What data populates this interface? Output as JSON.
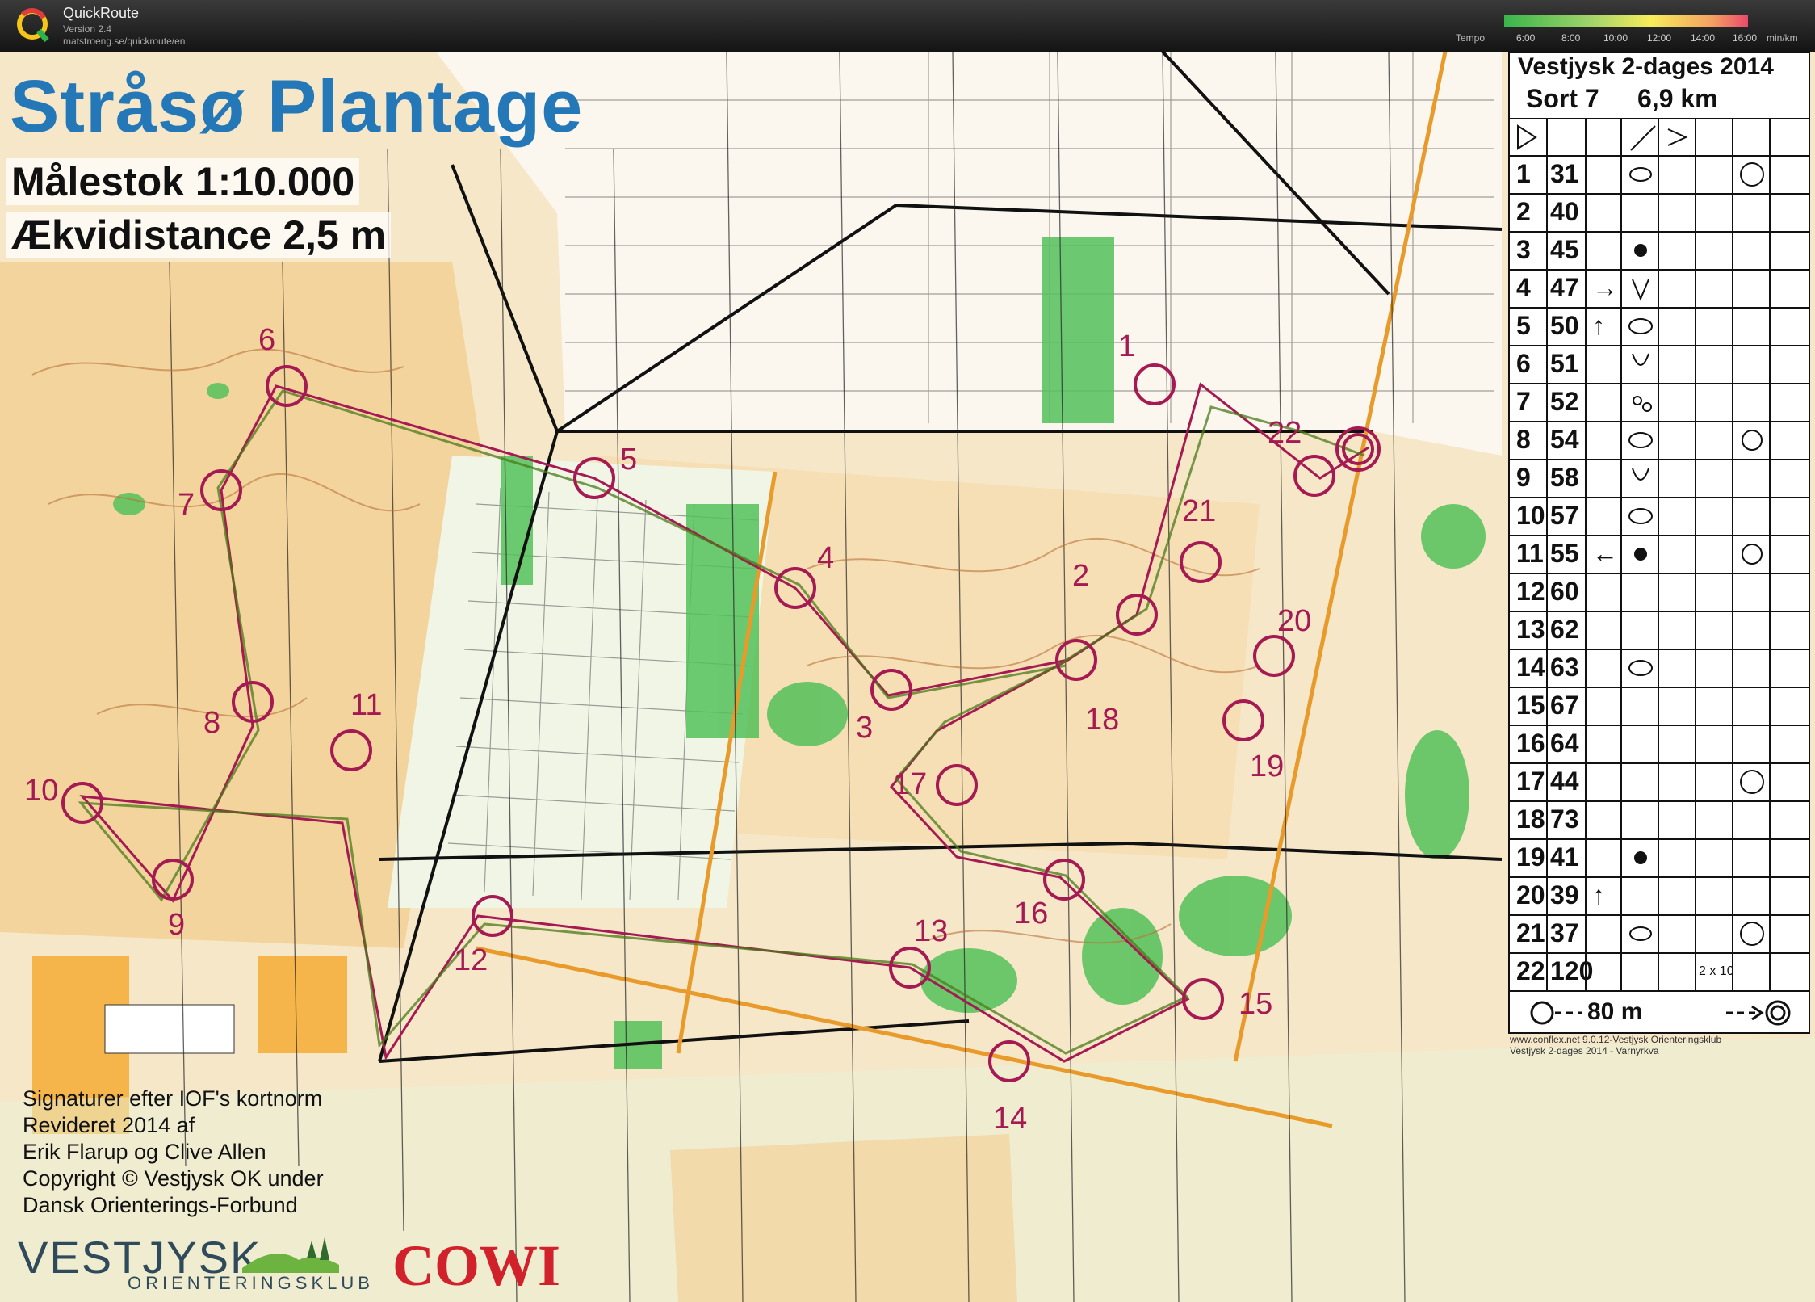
{
  "app": {
    "name": "QuickRoute",
    "version": "Version 2.4",
    "url": "matstroeng.se/quickroute/en",
    "tempo_label": "Tempo",
    "tempo_unit": "min/km",
    "scale_ticks": [
      "6:00",
      "8:00",
      "10:00",
      "12:00",
      "14:00",
      "16:00"
    ]
  },
  "map": {
    "title": "Stråsø Plantage",
    "scale_text": "Målestok 1:10.000",
    "contour_text": "Ækvidistance 2,5 m",
    "credits": [
      "Signaturer efter IOF's kortnorm",
      "Revideret 2014 af",
      "Erik Flarup og Clive Allen",
      "Copyright © Vestjysk OK under",
      "Dansk Orienterings-Forbund"
    ],
    "club_logo": "VESTJYSK",
    "club_logo_sub": "ORIENTERINGSKLUB",
    "sponsor": "COWI",
    "print_note_1": "www.conflex.net 9.0.12-Vestjysk Orienteringsklub",
    "print_note_2": "Vestjysk 2-dages 2014 - Varnyrkva"
  },
  "controls": [
    {
      "label": "1"
    },
    {
      "label": "2"
    },
    {
      "label": "3"
    },
    {
      "label": "4"
    },
    {
      "label": "5"
    },
    {
      "label": "6"
    },
    {
      "label": "7"
    },
    {
      "label": "8"
    },
    {
      "label": "9"
    },
    {
      "label": "10"
    },
    {
      "label": "11"
    },
    {
      "label": "12"
    },
    {
      "label": "13"
    },
    {
      "label": "14"
    },
    {
      "label": "15"
    },
    {
      "label": "16"
    },
    {
      "label": "17"
    },
    {
      "label": "18"
    },
    {
      "label": "19"
    },
    {
      "label": "20"
    },
    {
      "label": "21"
    },
    {
      "label": "22"
    }
  ],
  "description": {
    "event": "Vestjysk 2-dages 2014",
    "class": "Sort 7",
    "length": "6,9 km",
    "rows": [
      {
        "n": "1",
        "code": "31",
        "dir": "",
        "extra": ""
      },
      {
        "n": "2",
        "code": "40",
        "dir": "",
        "extra": ""
      },
      {
        "n": "3",
        "code": "45",
        "dir": "",
        "extra": ""
      },
      {
        "n": "4",
        "code": "47",
        "dir": "→",
        "extra": ""
      },
      {
        "n": "5",
        "code": "50",
        "dir": "↑",
        "extra": ""
      },
      {
        "n": "6",
        "code": "51",
        "dir": "",
        "extra": ""
      },
      {
        "n": "7",
        "code": "52",
        "dir": "",
        "extra": ""
      },
      {
        "n": "8",
        "code": "54",
        "dir": "",
        "extra": ""
      },
      {
        "n": "9",
        "code": "58",
        "dir": "",
        "extra": ""
      },
      {
        "n": "10",
        "code": "57",
        "dir": "",
        "extra": ""
      },
      {
        "n": "11",
        "code": "55",
        "dir": "←",
        "extra": ""
      },
      {
        "n": "12",
        "code": "60",
        "dir": "",
        "extra": ""
      },
      {
        "n": "13",
        "code": "62",
        "dir": "",
        "extra": ""
      },
      {
        "n": "14",
        "code": "63",
        "dir": "",
        "extra": ""
      },
      {
        "n": "15",
        "code": "67",
        "dir": "",
        "extra": ""
      },
      {
        "n": "16",
        "code": "64",
        "dir": "",
        "extra": ""
      },
      {
        "n": "17",
        "code": "44",
        "dir": "",
        "extra": ""
      },
      {
        "n": "18",
        "code": "73",
        "dir": "",
        "extra": ""
      },
      {
        "n": "19",
        "code": "41",
        "dir": "",
        "extra": ""
      },
      {
        "n": "20",
        "code": "39",
        "dir": "↑",
        "extra": ""
      },
      {
        "n": "21",
        "code": "37",
        "dir": "",
        "extra": ""
      },
      {
        "n": "22",
        "code": "120",
        "dir": "",
        "extra": "2 x 10"
      }
    ],
    "finish_distance": "80 m"
  },
  "colors": {
    "course": "#a51a52",
    "route": "#5a7a2a",
    "forest_green": "#4fbf4f",
    "open_land": "#f5c98a",
    "title_blue": "#2578b8",
    "sponsor_red": "#d1222b"
  }
}
